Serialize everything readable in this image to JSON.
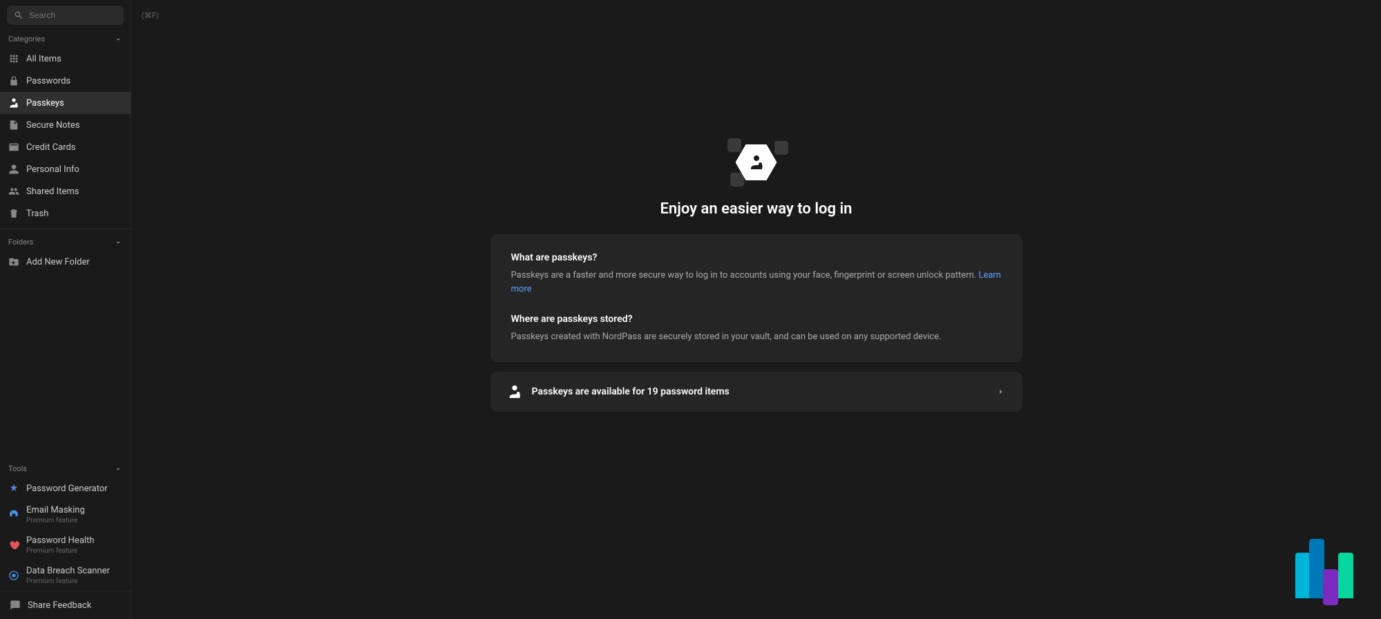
{
  "search": {
    "placeholder": "Search",
    "shortcut": "(⌘F)"
  },
  "sidebar": {
    "categories_label": "Categories",
    "items": [
      {
        "label": "All Items"
      },
      {
        "label": "Passwords"
      },
      {
        "label": "Passkeys"
      },
      {
        "label": "Secure Notes"
      },
      {
        "label": "Credit Cards"
      },
      {
        "label": "Personal Info"
      },
      {
        "label": "Shared Items"
      },
      {
        "label": "Trash"
      }
    ],
    "folders_label": "Folders",
    "add_folder": "Add New Folder",
    "tools_label": "Tools",
    "tools": [
      {
        "label": "Password Generator",
        "sub": ""
      },
      {
        "label": "Email Masking",
        "sub": "Premium feature"
      },
      {
        "label": "Password Health",
        "sub": "Premium feature"
      },
      {
        "label": "Data Breach Scanner",
        "sub": "Premium feature"
      }
    ],
    "feedback": "Share Feedback"
  },
  "main": {
    "title": "Enjoy an easier way to log in",
    "q1_title": "What are passkeys?",
    "q1_body": "Passkeys are a faster and more secure way to log in to accounts using your face, fingerprint or screen unlock pattern. ",
    "q1_link": "Learn more",
    "q2_title": "Where are passkeys stored?",
    "q2_body": "Passkeys created with NordPass are securely stored in your vault, and can be used on any supported device.",
    "action_text": "Passkeys are available for 19 password items"
  }
}
